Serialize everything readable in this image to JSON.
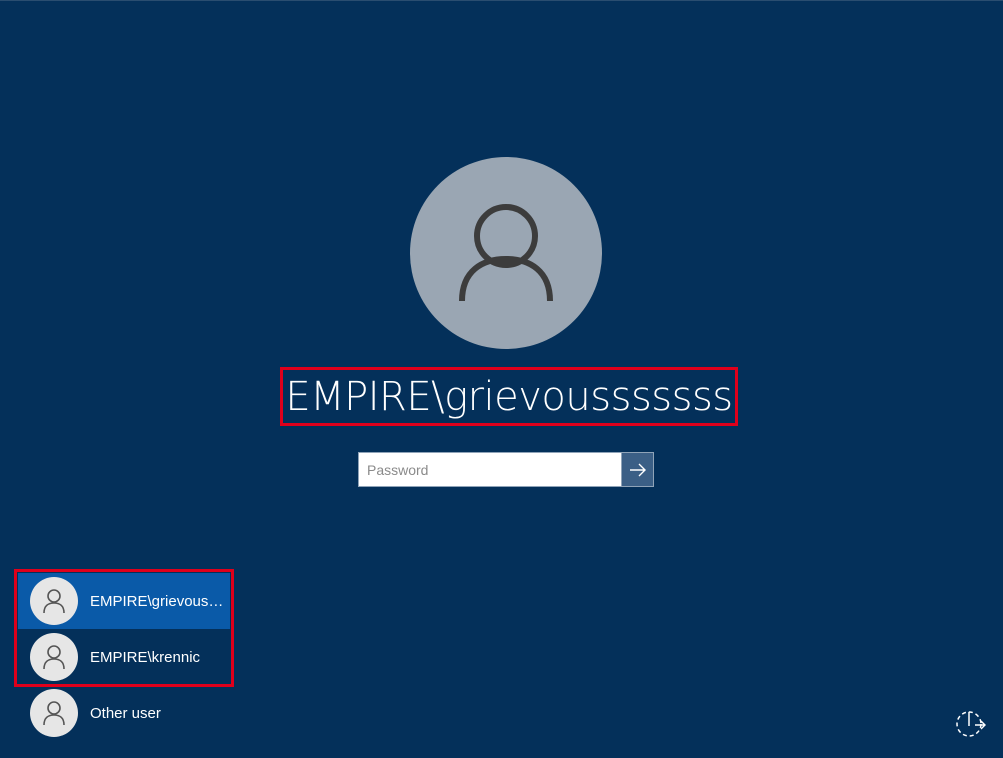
{
  "current_user": {
    "display_name": "EMPIRE\\grievousssssss"
  },
  "password": {
    "placeholder": "Password",
    "value": ""
  },
  "user_list": [
    {
      "name": "EMPIRE\\grievouss...",
      "selected": true
    },
    {
      "name": "EMPIRE\\krennic",
      "selected": false
    },
    {
      "name": "Other user",
      "selected": false
    }
  ],
  "icons": {
    "big_avatar": "user-icon",
    "submit": "arrow-right-icon",
    "power": "power-icon"
  },
  "colors": {
    "background": "#04305a",
    "selected_user": "#0a5aa8",
    "avatar_big": "#9aa6b3",
    "highlight": "#e0001b"
  }
}
